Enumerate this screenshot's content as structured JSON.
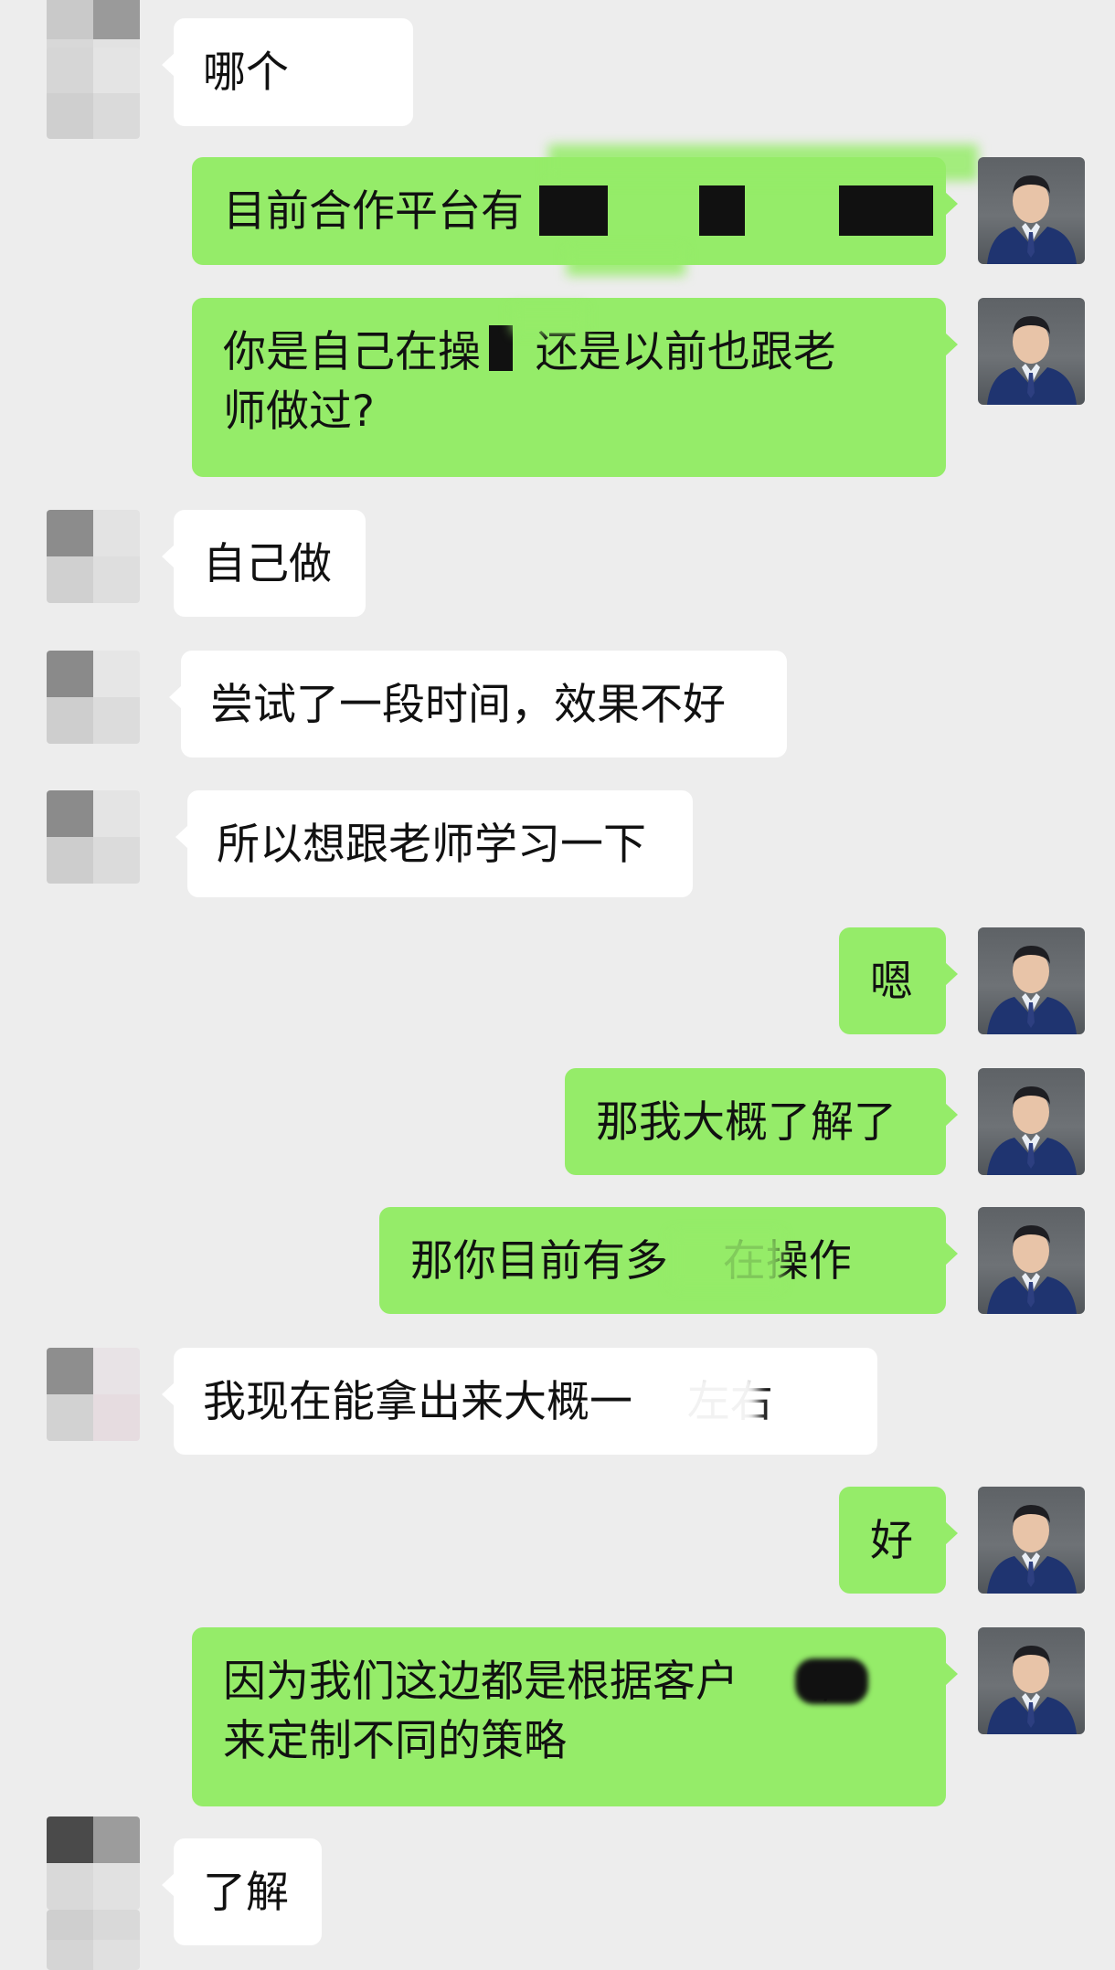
{
  "chat": {
    "messages": [
      {
        "side": "in",
        "text": "哪个"
      },
      {
        "side": "out",
        "text": "目前合作平台有"
      },
      {
        "side": "out",
        "text": "你是自己在操    还是以前也跟老\n师做过?"
      },
      {
        "side": "in",
        "text": "自己做"
      },
      {
        "side": "in",
        "text": "尝试了一段时间，效果不好"
      },
      {
        "side": "in",
        "text": "所以想跟老师学习一下"
      },
      {
        "side": "out",
        "text": "嗯"
      },
      {
        "side": "out",
        "text": "那我大概了解了"
      },
      {
        "side": "out",
        "text": "那你目前有多    在操作"
      },
      {
        "side": "in",
        "text": "我现在能拿出来大概一    左右"
      },
      {
        "side": "out",
        "text": "好"
      },
      {
        "side": "out",
        "text": "因为我们这边都是根据客户      ,\n来定制不同的策略"
      },
      {
        "side": "in",
        "text": "了解"
      }
    ]
  },
  "colors": {
    "background": "#EDEDED",
    "incoming_bubble": "#FFFFFF",
    "outgoing_bubble": "#95EC69",
    "text": "#111111"
  },
  "icons": {
    "incoming_avatar": "pixelated-avatar-icon",
    "outgoing_avatar": "user-portrait-avatar-icon"
  }
}
